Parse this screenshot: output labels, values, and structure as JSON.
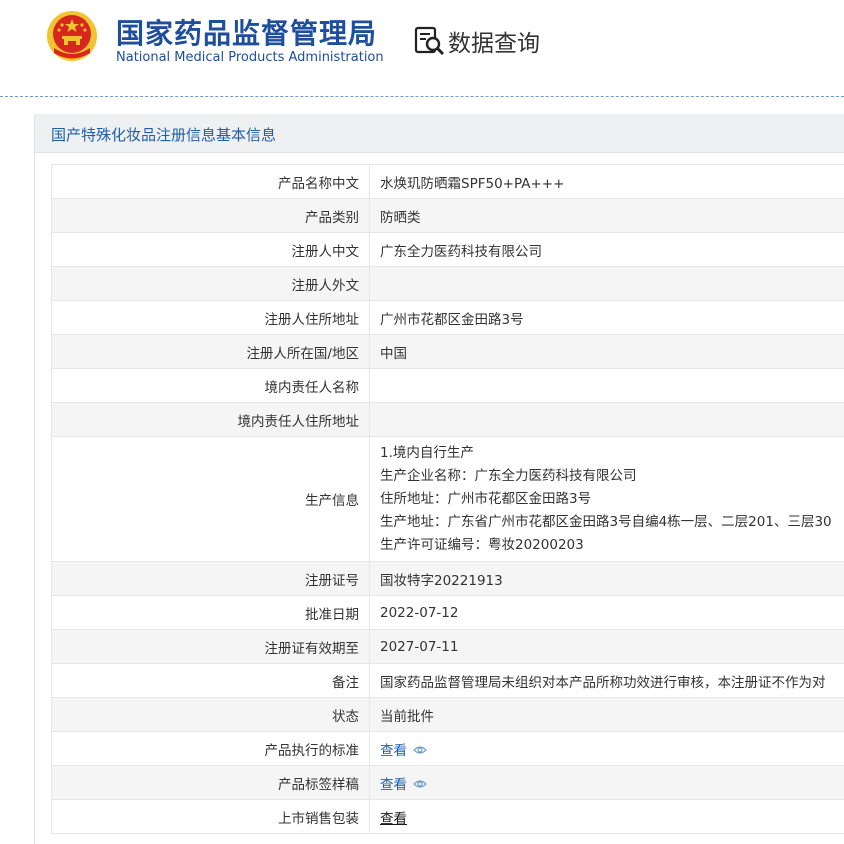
{
  "header": {
    "agency_cn": "国家药品监督管理局",
    "agency_en": "National Medical Products Administration",
    "query_label": "数据查询"
  },
  "panel": {
    "title": "国产特殊化妆品注册信息基本信息"
  },
  "rows": [
    {
      "label": "产品名称中文",
      "value": "水焕玑防晒霜SPF50+PA+++"
    },
    {
      "label": "产品类别",
      "value": "防晒类"
    },
    {
      "label": "注册人中文",
      "value": "广东全力医药科技有限公司"
    },
    {
      "label": "注册人外文",
      "value": ""
    },
    {
      "label": "注册人住所地址",
      "value": "广州市花都区金田路3号"
    },
    {
      "label": "注册人所在国/地区",
      "value": "中国"
    },
    {
      "label": "境内责任人名称",
      "value": ""
    },
    {
      "label": "境内责任人住所地址",
      "value": ""
    },
    {
      "label": "生产信息",
      "lines": [
        "1.境内自行生产",
        "生产企业名称：广东全力医药科技有限公司",
        "住所地址：广州市花都区金田路3号",
        "生产地址：广东省广州市花都区金田路3号自编4栋一层、二层201、三层30",
        "生产许可证编号：粤妆20200203"
      ]
    },
    {
      "label": "注册证号",
      "value": "国妆特字20221913"
    },
    {
      "label": "批准日期",
      "value": "2022-07-12"
    },
    {
      "label": "注册证有效期至",
      "value": "2027-07-11"
    },
    {
      "label": "备注",
      "value": "国家药品监督管理局未组织对本产品所称功效进行审核，本注册证不作为对"
    },
    {
      "label": "状态",
      "value": "当前批件"
    },
    {
      "label": "产品执行的标准",
      "link": "查看"
    },
    {
      "label": "产品标签样稿",
      "link": "查看"
    },
    {
      "label": "上市销售包装",
      "link": "查看"
    }
  ],
  "colors": {
    "brand_blue": "#1f4e9c",
    "link_blue": "#1f5fa8",
    "emblem_red": "#d7261e",
    "emblem_gold": "#f2c230"
  },
  "icons": {
    "emblem": "national-emblem-icon",
    "query": "search-document-icon",
    "eye": "eye-icon"
  }
}
